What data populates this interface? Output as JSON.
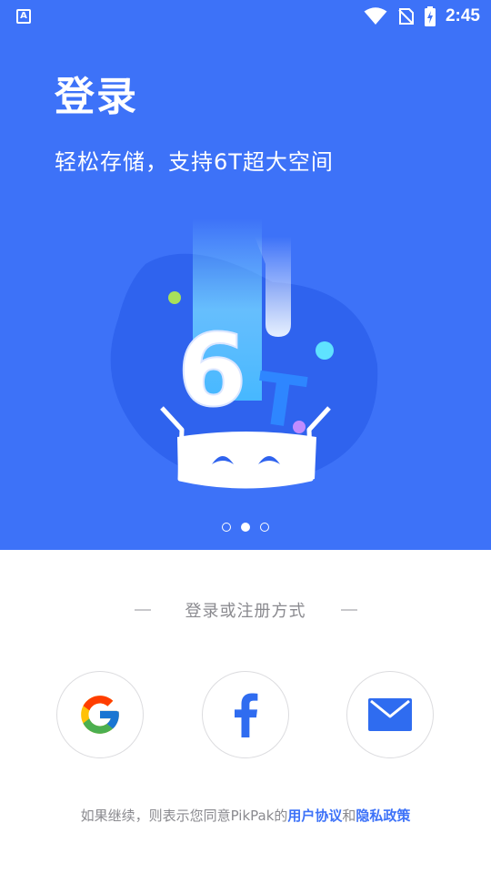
{
  "status_bar": {
    "time": "2:45",
    "icons": [
      "app-notification-icon",
      "wifi-icon",
      "no-signal-icon",
      "battery-charging-icon"
    ],
    "app_letter": "A"
  },
  "hero": {
    "title": "登录",
    "subtitle": "轻松存储，支持6T超大空间",
    "illustration": "6T storage mascot",
    "background_color": "#3d72f8",
    "pagination": {
      "total": 3,
      "active_index": 1
    }
  },
  "login": {
    "divider_label": "登录或注册方式",
    "providers": [
      {
        "name": "google",
        "icon": "google-icon"
      },
      {
        "name": "facebook",
        "icon": "facebook-icon"
      },
      {
        "name": "email",
        "icon": "mail-icon"
      }
    ]
  },
  "agreement": {
    "prefix": "如果继续，则表示您同意PikPak的",
    "user_agreement": "用户协议",
    "conjunction": "和",
    "privacy_policy": "隐私政策",
    "link_color": "#3d72f8"
  }
}
